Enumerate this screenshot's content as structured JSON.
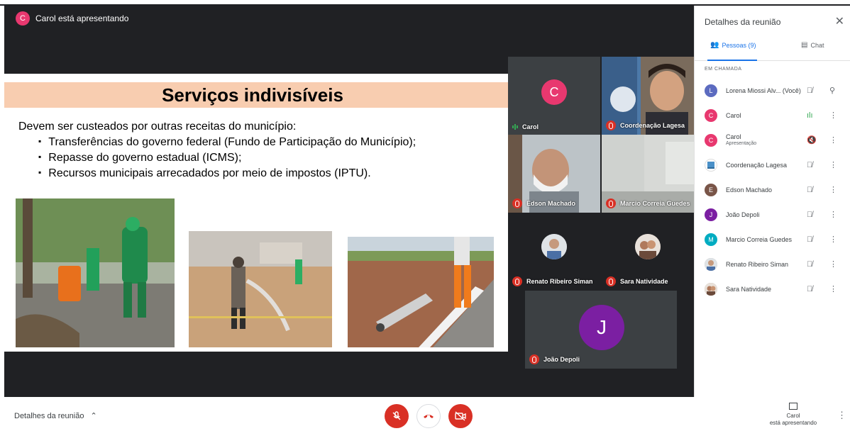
{
  "presenter_chip": {
    "initial": "C",
    "text": "Carol está apresentando"
  },
  "slide": {
    "title": "Serviços indivisíveis",
    "intro": "Devem ser custeados por outras receitas do município:",
    "bullets": [
      "Transferências do governo federal (Fundo de Participação do Município);",
      "Repasse do governo estadual (ICMS);",
      "Recursos municipais arrecadados por meio de impostos (IPTU)."
    ]
  },
  "tiles": [
    {
      "name": "Carol",
      "initial": "C"
    },
    {
      "name": "Coordenação Lagesa"
    },
    {
      "name": "Edson Machado"
    },
    {
      "name": "Marcio Correia Guedes"
    },
    {
      "name": "Renato Ribeiro Siman"
    },
    {
      "name": "Sara Natividade"
    },
    {
      "name": "João Depoli",
      "initial": "J"
    }
  ],
  "panel": {
    "title": "Detalhes da reunião",
    "tab_people": "Pessoas (9)",
    "tab_chat": "Chat",
    "section": "EM CHAMADA",
    "people": [
      {
        "initial": "L",
        "name": "Lorena Miossi Alv...",
        "extra": "(Você)",
        "color": "#5c6bc0"
      },
      {
        "initial": "C",
        "name": "Carol",
        "color": "#e8386f"
      },
      {
        "initial": "C",
        "name": "Carol",
        "sub": "Apresentação",
        "color": "#e8386f"
      },
      {
        "initial": "",
        "name": "Coordenação Lagesa",
        "color": "#ffffff"
      },
      {
        "initial": "E",
        "name": "Edson Machado",
        "color": "#795548"
      },
      {
        "initial": "J",
        "name": "João Depoli",
        "color": "#7b1fa2"
      },
      {
        "initial": "M",
        "name": "Marcio Correia Guedes",
        "color": "#00acc1"
      },
      {
        "initial": "",
        "name": "Renato Ribeiro Siman",
        "color": "#9e9e9e"
      },
      {
        "initial": "",
        "name": "Sara Natividade",
        "color": "#a1887f"
      }
    ]
  },
  "bottom": {
    "details": "Detalhes da reunião",
    "present_name": "Carol",
    "present_text": "está apresentando"
  },
  "colors": {
    "accent": "#1a73e8",
    "danger": "#d93025",
    "brand_pink": "#e8386f",
    "purple": "#7b1fa2"
  }
}
